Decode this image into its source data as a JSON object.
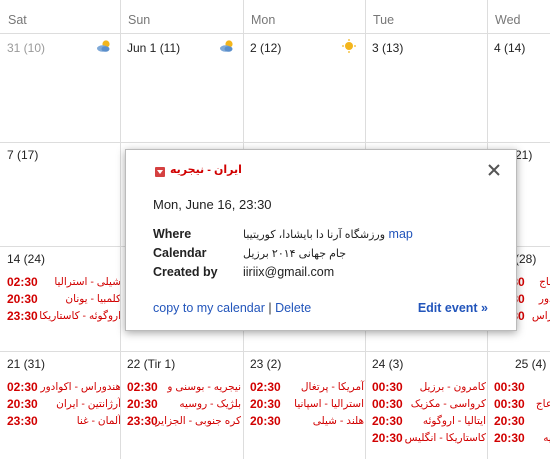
{
  "days_of_week": [
    "Sat",
    "Sun",
    "Mon",
    "Tue",
    "Wed"
  ],
  "weeks": [
    [
      {
        "label": "31 (10)",
        "grey": true,
        "weather": "partly-sunny-icon",
        "events": []
      },
      {
        "label": "Jun 1 (11)",
        "grey": false,
        "weather": "partly-sunny-icon",
        "events": []
      },
      {
        "label": "2 (12)",
        "grey": false,
        "weather": "sun-icon",
        "events": []
      },
      {
        "label": "3 (13)",
        "grey": false,
        "weather": "",
        "events": []
      },
      {
        "label": "4 (14)",
        "grey": false,
        "weather": "",
        "events": []
      }
    ],
    [
      {
        "label": "7 (17)",
        "grey": false,
        "weather": "",
        "events": []
      },
      {
        "label": "",
        "grey": false,
        "weather": "",
        "events": []
      },
      {
        "label": "",
        "grey": false,
        "weather": "",
        "events": []
      },
      {
        "label": "",
        "grey": false,
        "weather": "",
        "events": []
      },
      {
        "label": "21)",
        "grey": false,
        "weather": "",
        "events": []
      }
    ],
    [
      {
        "label": "14 (24)",
        "grey": false,
        "weather": "",
        "events": [
          {
            "time": "02:30",
            "name": "شیلی - استرالیا"
          },
          {
            "time": "20:30",
            "name": "کلمبیا - یونان"
          },
          {
            "time": "23:30",
            "name": "اروگوئه - کاستاریکا"
          }
        ]
      },
      {
        "label": "",
        "grey": false,
        "weather": "",
        "events": []
      },
      {
        "label": "",
        "grey": false,
        "weather": "",
        "events": [
          {
            "time": "23:30",
            "name": "ایران - نیجریه",
            "faded": true
          }
        ]
      },
      {
        "label": "",
        "grey": false,
        "weather": "",
        "events": []
      },
      {
        "label": "(28)",
        "grey": false,
        "weather": "",
        "events": [
          {
            "time": "02:30",
            "name": "ژاپن - ساحل عاج"
          },
          {
            "time": "20:30",
            "name": "سوییس - اکوادور"
          },
          {
            "time": "23:30",
            "name": "فرانسه - هندوراس"
          }
        ]
      }
    ],
    [
      {
        "label": "21 (31)",
        "grey": false,
        "weather": "",
        "events": [
          {
            "time": "02:30",
            "name": "هندوراس - اکوادور"
          },
          {
            "time": "20:30",
            "name": "آرژانتین - ایران"
          },
          {
            "time": "23:30",
            "name": "آلمان - غنا"
          }
        ]
      },
      {
        "label": "22 (Tir 1)",
        "grey": false,
        "weather": "",
        "events": [
          {
            "time": "02:30",
            "name": "نیجریه - بوسنی و"
          },
          {
            "time": "20:30",
            "name": "بلژیک - روسیه"
          },
          {
            "time": "23:30",
            "name": "کره جنوبی - الجزایر"
          }
        ]
      },
      {
        "label": "23 (2)",
        "grey": false,
        "weather": "",
        "events": [
          {
            "time": "02:30",
            "name": "آمریکا - پرتغال"
          },
          {
            "time": "20:30",
            "name": "استرالیا - اسپانیا"
          },
          {
            "time": "20:30",
            "name": "هلند - شیلی"
          }
        ]
      },
      {
        "label": "24 (3)",
        "grey": false,
        "weather": "",
        "events": [
          {
            "time": "00:30",
            "name": "کامرون - برزیل"
          },
          {
            "time": "00:30",
            "name": "کرواسی - مکزیک"
          },
          {
            "time": "20:30",
            "name": "ایتالیا - اروگوئه"
          },
          {
            "time": "20:30",
            "name": "کاستاریکا - انگلیس"
          }
        ]
      },
      {
        "label": "25 (4)",
        "grey": false,
        "weather": "",
        "events": [
          {
            "time": "00:30",
            "name": "ژاپن - کلمبیا"
          },
          {
            "time": "00:30",
            "name": "یونان - ساحل عاج"
          },
          {
            "time": "20:30",
            "name": "بوسنی - ایران"
          },
          {
            "time": "20:30",
            "name": "آرژانتین - نیجریه"
          }
        ]
      }
    ]
  ],
  "popup": {
    "title": "ایران - نیجریه",
    "when": "Mon, June 16, 23:30",
    "where_label": "Where",
    "where_value": "ورزشگاه آرنا دا بایشادا، کوریتیبا",
    "map_link": "map",
    "calendar_label": "Calendar",
    "calendar_value": "جام جهانی ۲۰۱۴ برزیل",
    "created_label": "Created by",
    "created_value": "iiriix@gmail.com",
    "copy_link": "copy to my calendar",
    "separator": "|",
    "delete_link": "Delete",
    "edit_link": "Edit event »"
  }
}
